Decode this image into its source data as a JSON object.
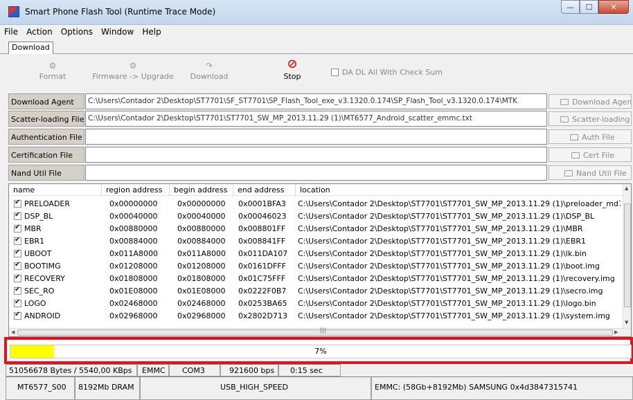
{
  "window": {
    "title": "Smart Phone Flash Tool (Runtime Trace Mode)",
    "controls": {
      "minimize": "—",
      "maximize": "☐",
      "close": "✕"
    }
  },
  "menu": [
    "File",
    "Action",
    "Options",
    "Window",
    "Help"
  ],
  "tabs": [
    "Download"
  ],
  "toolbar": {
    "format": "Format",
    "firmware_upgrade": "Firmware -> Upgrade",
    "download": "Download",
    "stop": "Stop",
    "da_dl_checksum": "DA DL All With Check Sum"
  },
  "files": [
    {
      "label": "Download Agent",
      "path": "C:\\Users\\Contador 2\\Desktop\\ST7701\\SF_ST7701\\SP_Flash_Tool_exe_v3.1320.0.174\\SP_Flash_Tool_v3.1320.0.174\\MTK",
      "button": "Download Agent"
    },
    {
      "label": "Scatter-loading File",
      "path": "C:\\Users\\Contador 2\\Desktop\\ST7701\\ST7701_SW_MP_2013.11.29 (1)\\MT6577_Android_scatter_emmc.txt",
      "button": "Scatter-loading"
    },
    {
      "label": "Authentication File",
      "path": "",
      "button": "Auth File"
    },
    {
      "label": "Certification File",
      "path": "",
      "button": "Cert File"
    },
    {
      "label": "Nand Util File",
      "path": "",
      "button": "Nand Util File"
    }
  ],
  "table": {
    "headers": [
      "name",
      "region address",
      "begin address",
      "end address",
      "location"
    ],
    "rows": [
      {
        "name": "PRELOADER",
        "region": "0x00000000",
        "begin": "0x00000000",
        "end": "0x0001BFA3",
        "location": "C:\\Users\\Contador 2\\Desktop\\ST7701\\ST7701_SW_MP_2013.11.29 (1)\\preloader_md7"
      },
      {
        "name": "DSP_BL",
        "region": "0x00040000",
        "begin": "0x00040000",
        "end": "0x00046023",
        "location": "C:\\Users\\Contador 2\\Desktop\\ST7701\\ST7701_SW_MP_2013.11.29 (1)\\DSP_BL"
      },
      {
        "name": "MBR",
        "region": "0x00880000",
        "begin": "0x00880000",
        "end": "0x008801FF",
        "location": "C:\\Users\\Contador 2\\Desktop\\ST7701\\ST7701_SW_MP_2013.11.29 (1)\\MBR"
      },
      {
        "name": "EBR1",
        "region": "0x00884000",
        "begin": "0x00884000",
        "end": "0x008841FF",
        "location": "C:\\Users\\Contador 2\\Desktop\\ST7701\\ST7701_SW_MP_2013.11.29 (1)\\EBR1"
      },
      {
        "name": "UBOOT",
        "region": "0x011A8000",
        "begin": "0x011A8000",
        "end": "0x011DA107",
        "location": "C:\\Users\\Contador 2\\Desktop\\ST7701\\ST7701_SW_MP_2013.11.29 (1)\\lk.bin"
      },
      {
        "name": "BOOTIMG",
        "region": "0x01208000",
        "begin": "0x01208000",
        "end": "0x0161DFFF",
        "location": "C:\\Users\\Contador 2\\Desktop\\ST7701\\ST7701_SW_MP_2013.11.29 (1)\\boot.img"
      },
      {
        "name": "RECOVERY",
        "region": "0x01808000",
        "begin": "0x01808000",
        "end": "0x01C75FFF",
        "location": "C:\\Users\\Contador 2\\Desktop\\ST7701\\ST7701_SW_MP_2013.11.29 (1)\\recovery.img"
      },
      {
        "name": "SEC_RO",
        "region": "0x01E08000",
        "begin": "0x01E08000",
        "end": "0x0222F0B7",
        "location": "C:\\Users\\Contador 2\\Desktop\\ST7701\\ST7701_SW_MP_2013.11.29 (1)\\secro.img"
      },
      {
        "name": "LOGO",
        "region": "0x02468000",
        "begin": "0x02468000",
        "end": "0x0253BA65",
        "location": "C:\\Users\\Contador 2\\Desktop\\ST7701\\ST7701_SW_MP_2013.11.29 (1)\\logo.bin"
      },
      {
        "name": "ANDROID",
        "region": "0x02968000",
        "begin": "0x02968000",
        "end": "0x2802D713",
        "location": "C:\\Users\\Contador 2\\Desktop\\ST7701\\ST7701_SW_MP_2013.11.29 (1)\\system.img"
      }
    ]
  },
  "progress": {
    "text": "7%",
    "value": 0.07,
    "color": "#ffff00",
    "highlight_color": "#e0141c"
  },
  "status": {
    "bytes": "51056678 Bytes / 5540,00 KBps",
    "storage": "EMMC",
    "port": "COM3",
    "baud": "921600 bps",
    "time": "0:15 sec",
    "chip": "MT6577_S00",
    "dram": "8192Mb DRAM",
    "usb": "USB_HIGH_SPEED",
    "emmc_info": "EMMC: (58Gb+8192Mb) SAMSUNG 0x4d3847315741"
  }
}
